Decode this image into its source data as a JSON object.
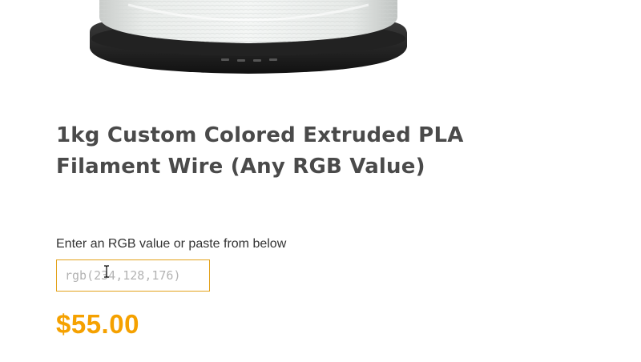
{
  "product": {
    "image_name": "filament-spool",
    "title": "1kg Custom Colored Extruded PLA Filament Wire (Any RGB Value)",
    "price": "$55.00"
  },
  "rgb_field": {
    "label": "Enter an RGB value or paste from below",
    "placeholder": "rgb(234,128,176)",
    "value": ""
  },
  "colors": {
    "title_text": "#4a4a4a",
    "input_border": "#e3a21b",
    "price": "#f5a100",
    "placeholder": "#b3b3b3"
  },
  "icons": {
    "cursor": "text-cursor-icon"
  }
}
